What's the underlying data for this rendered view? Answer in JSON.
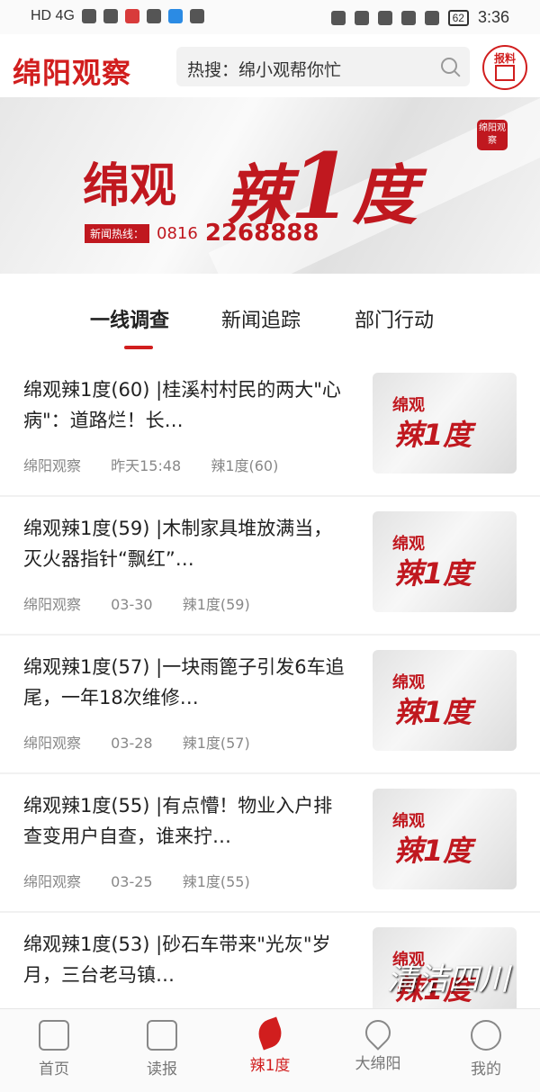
{
  "status_bar": {
    "left_label": "HD 4G",
    "battery": "62",
    "time": "3:36"
  },
  "header": {
    "logo": "绵阳观察",
    "search_text": "热搜：绵小观帮你忙",
    "report_label": "报料"
  },
  "banner": {
    "name": "绵观",
    "title_a": "辣",
    "title_one": "1",
    "title_b": "度",
    "hotline_tag": "新闻热线：",
    "hotline_code": "0816",
    "hotline_number": "2268888",
    "seal": "绵阳观察"
  },
  "tabs": [
    {
      "label": "一线调查",
      "active": true
    },
    {
      "label": "新闻追踪"
    },
    {
      "label": "部门行动"
    }
  ],
  "news": [
    {
      "title": "绵观辣1度(60) |桂溪村村民的两大\"心病\"：道路烂！长…",
      "source": "绵阳观察",
      "time": "昨天15:48",
      "tag": "辣1度(60)"
    },
    {
      "title": "绵观辣1度(59) |木制家具堆放满当，灭火器指针“飘红”…",
      "source": "绵阳观察",
      "time": "03-30",
      "tag": "辣1度(59)"
    },
    {
      "title": "绵观辣1度(57) |一块雨篦子引发6车追尾，一年18次维修…",
      "source": "绵阳观察",
      "time": "03-28",
      "tag": "辣1度(57)"
    },
    {
      "title": "绵观辣1度(55) |有点懵！物业入户排查变用户自查，谁来拧…",
      "source": "绵阳观察",
      "time": "03-25",
      "tag": "辣1度(55)"
    },
    {
      "title": "绵观辣1度(53) |砂石车带来\"光灰\"岁月，三台老马镇…",
      "source": "",
      "time": "",
      "tag": ""
    }
  ],
  "thumb": {
    "small": "绵观",
    "big": "辣1度"
  },
  "bottom_nav": [
    {
      "label": "首页"
    },
    {
      "label": "读报"
    },
    {
      "label": "辣1度",
      "active": true
    },
    {
      "label": "大绵阳"
    },
    {
      "label": "我的"
    }
  ],
  "watermark": "清洁四川"
}
